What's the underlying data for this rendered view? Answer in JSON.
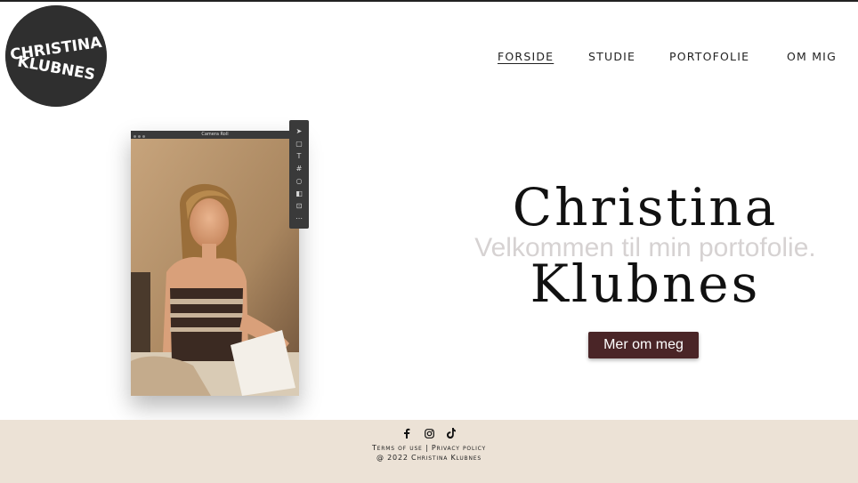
{
  "logo": {
    "line1": "CHRISTINA",
    "line2": "KLUBNES",
    "bg_color": "#2f2f2f"
  },
  "nav": {
    "items": [
      {
        "label": "FORSIDE",
        "active": true
      },
      {
        "label": "STUDIE",
        "active": false
      },
      {
        "label": "PORTOFOLIE",
        "active": false
      },
      {
        "label": "OM MIG",
        "active": false
      }
    ]
  },
  "photo": {
    "window_title": "Camera Roll"
  },
  "toolbar": {
    "icons": [
      "cursor-icon",
      "page-icon",
      "text-icon",
      "grid-icon",
      "circle-icon",
      "sticky-icon",
      "embed-icon",
      "more-icon"
    ]
  },
  "hero": {
    "first_name": "Christina",
    "last_name": "Klubnes",
    "welcome": "Velkommen til min portofolie.",
    "button_label": "Mer om meg",
    "button_color": "#4a2527"
  },
  "footer": {
    "bg_color": "#ece2d6",
    "social_icons": [
      "facebook-icon",
      "instagram-icon",
      "tiktok-icon"
    ],
    "terms": "Terms of use",
    "separator": "|",
    "privacy": "Privacy policy",
    "copyright": "@ 2022 Christina Klubnes"
  }
}
